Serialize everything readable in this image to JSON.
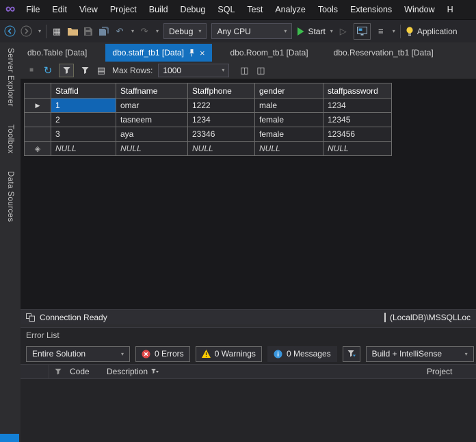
{
  "colors": {
    "active_tab_blue": "#1470bf",
    "selected_cell_blue": "#1165b4",
    "chrome_dark": "#2d2d30",
    "status_corner_blue": "#1380d6"
  },
  "menu": {
    "items": [
      "File",
      "Edit",
      "View",
      "Project",
      "Build",
      "Debug",
      "SQL",
      "Test",
      "Analyze",
      "Tools",
      "Extensions",
      "Window",
      "H"
    ]
  },
  "toolbar": {
    "debug_config": "Debug",
    "platform": "Any CPU",
    "start_label": "Start",
    "application_label": "Application"
  },
  "sidebar": {
    "items": [
      {
        "label": "Server Explorer"
      },
      {
        "label": "Toolbox"
      },
      {
        "label": "Data Sources"
      }
    ]
  },
  "tabs": [
    {
      "label": "dbo.Table [Data]",
      "active": false
    },
    {
      "label": "dbo.staff_tb1 [Data]",
      "active": true
    },
    {
      "label": "dbo.Room_tb1 [Data]",
      "active": false
    },
    {
      "label": "dbo.Reservation_tb1 [Data]",
      "active": false
    }
  ],
  "data_toolbar": {
    "max_rows_label": "Max Rows:",
    "max_rows_value": "1000"
  },
  "grid": {
    "columns": [
      "Staffid",
      "Staffname",
      "Staffphone",
      "gender",
      "staffpassword"
    ],
    "rows": [
      [
        "1",
        "omar",
        "1222",
        "male",
        "1234"
      ],
      [
        "2",
        "tasneem",
        "1234",
        "female",
        "12345"
      ],
      [
        "3",
        "aya",
        "23346",
        "female",
        "123456"
      ],
      [
        "NULL",
        "NULL",
        "NULL",
        "NULL",
        "NULL"
      ]
    ],
    "selected_cell": {
      "row": 0,
      "column": "Staffid"
    }
  },
  "status_bar": {
    "connection": "Connection Ready",
    "server": "(LocalDB)\\MSSQLLoc"
  },
  "error_list": {
    "title": "Error List",
    "scope": "Entire Solution",
    "errors": "0 Errors",
    "warnings": "0 Warnings",
    "messages": "0 Messages",
    "source": "Build + IntelliSense",
    "columns": {
      "code": "Code",
      "description": "Description",
      "project": "Project"
    }
  }
}
